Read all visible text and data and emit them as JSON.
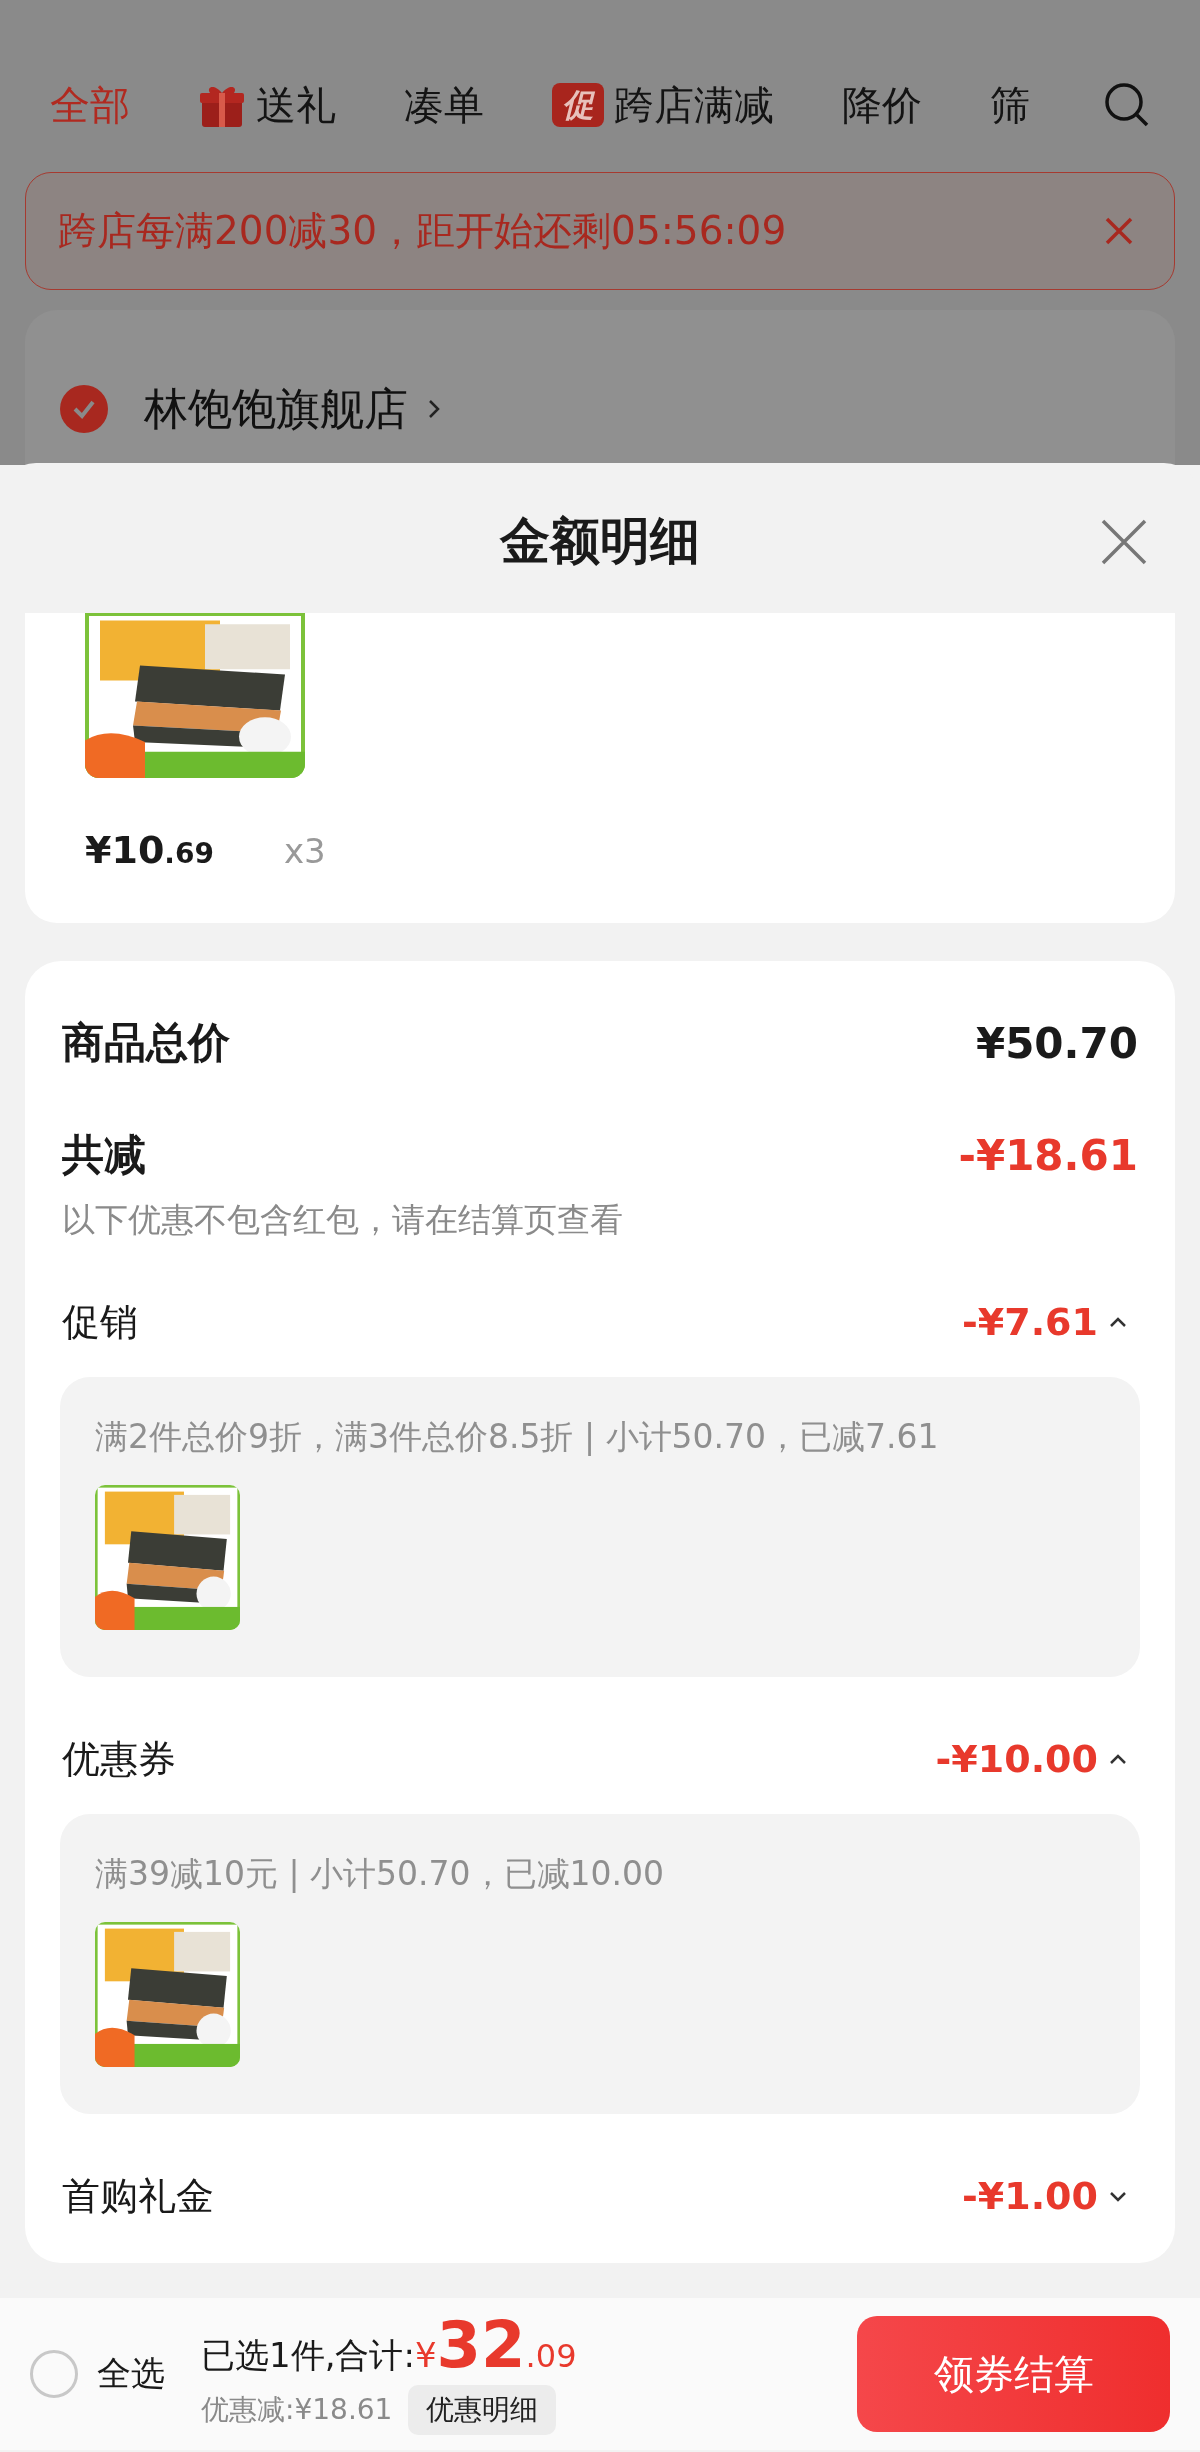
{
  "filter_tabs": [
    {
      "label": "全部",
      "selected": true,
      "kind": "text"
    },
    {
      "label": "送礼",
      "selected": false,
      "kind": "gift"
    },
    {
      "label": "凑单",
      "selected": false,
      "kind": "text"
    },
    {
      "label": "跨店满减",
      "selected": false,
      "kind": "badge",
      "badge": "促"
    },
    {
      "label": "降价",
      "selected": false,
      "kind": "text"
    },
    {
      "label": "筛",
      "selected": false,
      "kind": "text"
    }
  ],
  "promo_banner": {
    "text": "跨店每满200减30，距开始还剩05:56:09"
  },
  "store": {
    "name": "林饱饱旗舰店",
    "checked": true
  },
  "sheet": {
    "title": "金额明细",
    "product": {
      "kind": "picture",
      "price_main": "¥10",
      "price_cents": ".69",
      "quantity": "x3"
    },
    "summary": {
      "total_label": "商品总价",
      "total_value": "¥50.70",
      "discount_label": "共减",
      "discount_value": "-¥18.61",
      "note": "以下优惠不包含红包，请在结算页查看",
      "sections": [
        {
          "label": "促销",
          "value": "-¥7.61",
          "expanded": true,
          "detail": "满2件总价9折，满3件总价8.5折 | 小计50.70，已减7.61"
        },
        {
          "label": "优惠券",
          "value": "-¥10.00",
          "expanded": true,
          "detail": "满39减10元 | 小计50.70，已减10.00"
        },
        {
          "label": "首购礼金",
          "value": "-¥1.00",
          "expanded": false
        }
      ]
    }
  },
  "bottom_bar": {
    "select_all": {
      "label": "全选",
      "checked": false
    },
    "selected_text": "已选1件,合计:",
    "currency": "¥",
    "total_main": "32",
    "total_cents": ".09",
    "saving": "优惠减:¥18.61",
    "detail_button": "优惠明细",
    "checkout_button": "领券结算"
  }
}
